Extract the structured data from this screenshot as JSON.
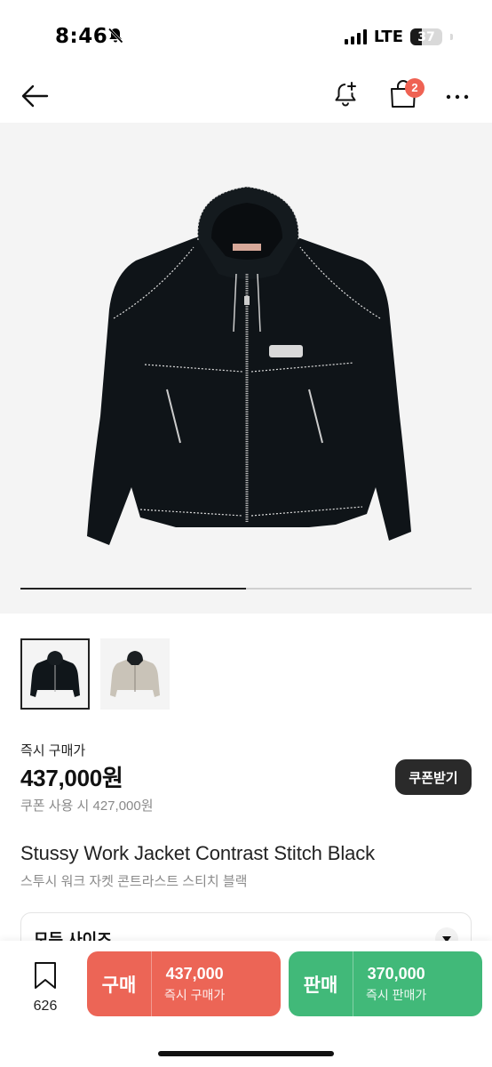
{
  "status_bar": {
    "time": "8:46",
    "network": "LTE",
    "battery_level": "37",
    "mute_icon": "bell-slash-icon",
    "signal_icon": "signal-bars-icon"
  },
  "nav": {
    "back_icon": "arrow-left-icon",
    "alert_icon": "bell-plus-icon",
    "bag_icon": "shopping-bag-icon",
    "bag_count": "2",
    "more_icon": "more-horizontal-icon",
    "badge_color": "#ef6253"
  },
  "gallery": {
    "progress": 0.5,
    "image_icon": "jacket-photo",
    "thumbnails": [
      {
        "color": "black",
        "selected": true
      },
      {
        "color": "grey",
        "selected": false
      }
    ]
  },
  "price": {
    "label": "즉시 구매가",
    "amount": "437,000원",
    "coupon_text": "쿠폰 사용 시 427,000원",
    "coupon_button": "쿠폰받기"
  },
  "product": {
    "title_en": "Stussy Work Jacket Contrast Stitch Black",
    "title_ko": "스투시 워크 자켓 콘트라스트 스티치 블랙"
  },
  "size_select": {
    "label": "모든 사이즈",
    "icon": "chevron-down-icon"
  },
  "bottom_bar": {
    "wish_icon": "bookmark-icon",
    "wish_count": "626",
    "buy": {
      "label": "구매",
      "price": "437,000",
      "sub": "즉시 구매가",
      "color": "#ec6556"
    },
    "sell": {
      "label": "판매",
      "price": "370,000",
      "sub": "즉시 판매가",
      "color": "#41b979"
    }
  }
}
